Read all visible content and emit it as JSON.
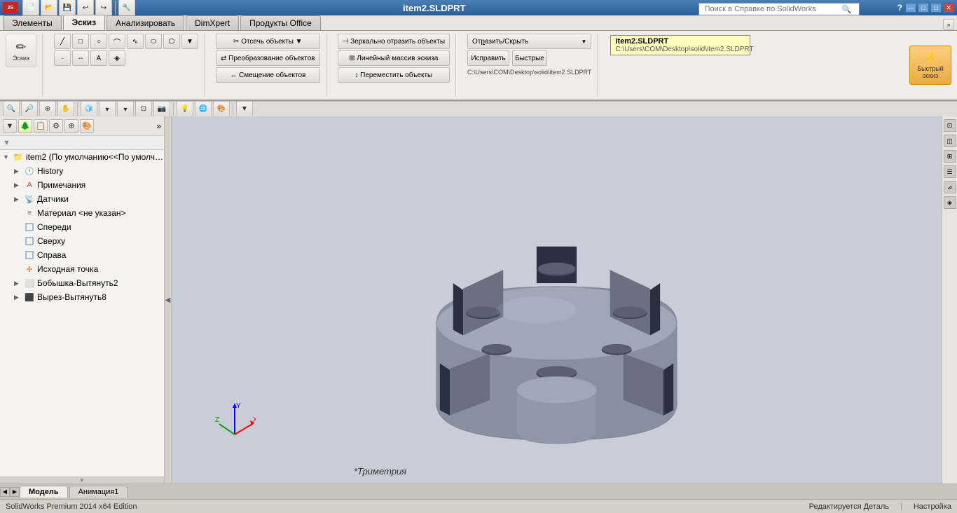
{
  "titlebar": {
    "app_name": "SolidWorks",
    "logo_text": "SW",
    "file_name": "item2.SLDPRT",
    "search_placeholder": "Поиск в Справке по SolidWorks",
    "win_buttons": [
      "—",
      "□",
      "✕"
    ],
    "help_icon": "?"
  },
  "toolbar_top": {
    "buttons": [
      "new",
      "open",
      "save",
      "print",
      "undo",
      "redo",
      "rebuild",
      "select"
    ]
  },
  "tabs": {
    "items": [
      "Элементы",
      "Эскиз",
      "Анализировать",
      "DimXpert",
      "Продукты Office"
    ],
    "active": 1
  },
  "ribbon": {
    "groups": [
      {
        "label": "Эскиз",
        "buttons": [
          {
            "label": "Эскиз",
            "large": true,
            "icon": "✏"
          }
        ]
      },
      {
        "label": "",
        "buttons": [
          {
            "label": "Отсечь объекты",
            "large": false,
            "icon": "✂"
          },
          {
            "label": "Преобразование объектов",
            "large": false,
            "icon": "⇄"
          },
          {
            "label": "Смещение объектов",
            "large": false,
            "icon": "↔"
          }
        ]
      },
      {
        "label": "",
        "buttons": [
          {
            "label": "Зеркально отразить объекты",
            "large": false
          },
          {
            "label": "Линейный массив эскиза",
            "large": false
          },
          {
            "label": "Переместить объекты",
            "large": false
          }
        ]
      },
      {
        "label": "",
        "buttons": [
          {
            "label": "Отразить/Скрыть",
            "large": false
          },
          {
            "label": "Исправить",
            "large": false
          },
          {
            "label": "Быстрые",
            "large": false
          }
        ]
      },
      {
        "label": "Быстрый эскиз",
        "large": true,
        "active": true,
        "icon": "⚡"
      }
    ]
  },
  "sidebar": {
    "toolbar_icons": [
      "filter",
      "folder",
      "group",
      "star",
      "color"
    ],
    "tree": [
      {
        "level": 0,
        "expander": "▼",
        "icon": "folder",
        "label": "item2  (По умолчанию<<По умолч…",
        "type": "root"
      },
      {
        "level": 1,
        "expander": "▶",
        "icon": "history",
        "label": "History",
        "type": "history"
      },
      {
        "level": 1,
        "expander": "▶",
        "icon": "annotation",
        "label": "Примечания",
        "type": "annotations"
      },
      {
        "level": 1,
        "expander": "▶",
        "icon": "sensor",
        "label": "Датчики",
        "type": "sensors"
      },
      {
        "level": 1,
        "expander": " ",
        "icon": "material",
        "label": "Материал <не указан>",
        "type": "material"
      },
      {
        "level": 1,
        "expander": " ",
        "icon": "plane",
        "label": "Спереди",
        "type": "plane"
      },
      {
        "level": 1,
        "expander": " ",
        "icon": "plane",
        "label": "Сверху",
        "type": "plane"
      },
      {
        "level": 1,
        "expander": " ",
        "icon": "plane",
        "label": "Справа",
        "type": "plane"
      },
      {
        "level": 1,
        "expander": " ",
        "icon": "origin",
        "label": "Исходная точка",
        "type": "origin"
      },
      {
        "level": 1,
        "expander": "▶",
        "icon": "boss",
        "label": "Бобышка-Вытянуть2",
        "type": "feature"
      },
      {
        "level": 1,
        "expander": "▶",
        "icon": "cut",
        "label": "Вырез-Вытянуть8",
        "type": "feature"
      }
    ]
  },
  "viewport": {
    "view_label": "*Триметрия",
    "bg_color": "#c8cdd8"
  },
  "viewport_toolbar": {
    "icons": [
      "zoom-in",
      "zoom-out",
      "pan",
      "3d-view",
      "wireframe",
      "shaded",
      "edges",
      "lighting",
      "more"
    ]
  },
  "file_path": {
    "filename": "item2.SLDPRT",
    "path": "C:\\Users\\COM\\Desktop\\solid\\item2.SLDPRT"
  },
  "bottom_tabs": {
    "items": [
      "Модель",
      "Анимация1"
    ],
    "active": 0
  },
  "status_bar": {
    "left": "SolidWorks Premium 2014 x64 Edition",
    "middle": "",
    "right_middle": "Редактируется Деталь",
    "right": "Настройка"
  }
}
